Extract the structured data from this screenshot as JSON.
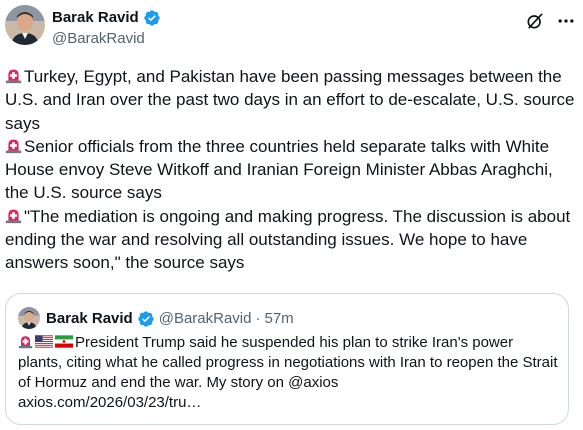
{
  "author": {
    "name": "Barak Ravid",
    "handle": "@BarakRavid"
  },
  "tweet": {
    "paragraphs": [
      "Turkey, Egypt, and Pakistan have been passing messages between the U.S. and Iran over the past two days in an effort to de-escalate, U.S. source says",
      "Senior officials from the three countries held separate talks with White House envoy Steve Witkoff and Iranian Foreign Minister Abbas Araghchi, the U.S. source says",
      "\"The mediation is ongoing and making progress. The discussion is about ending the war and resolving all outstanding issues. We hope to have answers soon,\" the source says"
    ]
  },
  "quote": {
    "name": "Barak Ravid",
    "handle": "@BarakRavid",
    "dot": "·",
    "time": "57m",
    "text": "President Trump said he suspended his plan to strike Iran's power plants, citing what he called progress in negotiations with Iran to reopen the Strait of Hormuz and end the war. My story on @axios",
    "link": "axios.com/2026/03/23/tru…"
  },
  "colors": {
    "text": "#0f1419",
    "secondary": "#536471",
    "verified": "#1d9bf0",
    "border": "#cfd9de",
    "siren": "#e0245e"
  },
  "icons": {
    "verified": "verified-badge-icon",
    "grok": "grok-icon",
    "more": "more-options-icon",
    "siren": "siren-icon",
    "us_flag": "us-flag-icon",
    "iran_flag": "iran-flag-icon"
  }
}
